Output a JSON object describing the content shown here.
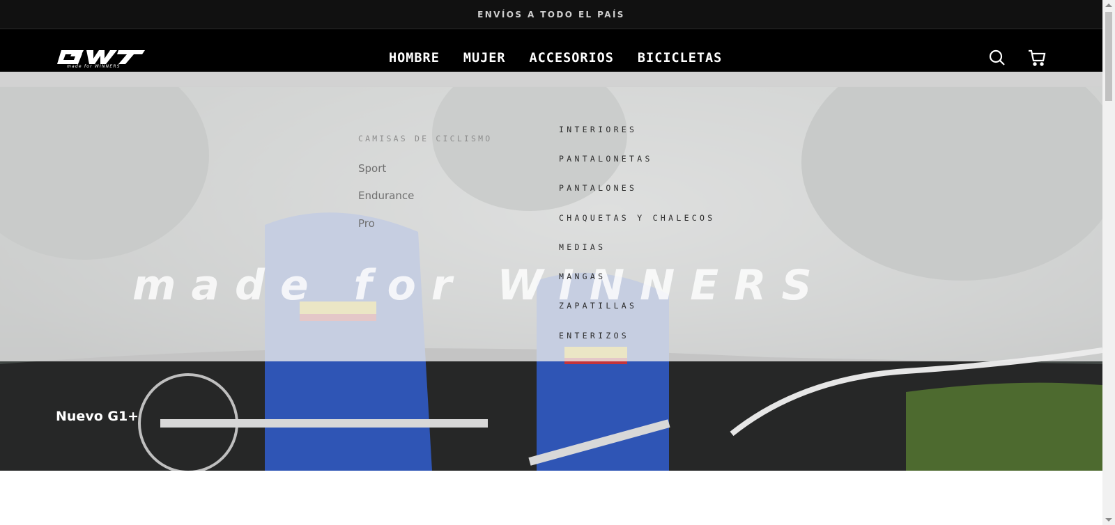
{
  "announcement": {
    "text": "ENVÍOS A TODO EL PAÍS"
  },
  "header": {
    "logo_text": "GW",
    "logo_tagline": "made for WINNERS",
    "nav": [
      {
        "label": "HOMBRE"
      },
      {
        "label": "MUJER"
      },
      {
        "label": "ACCESORIOS"
      },
      {
        "label": "BICICLETAS"
      }
    ],
    "search_icon": "search-icon",
    "cart_icon": "cart-icon"
  },
  "mega_menu": {
    "column1": {
      "heading": "CAMISAS DE CICLISMO",
      "items": [
        "Sport",
        "Endurance",
        "Pro"
      ]
    },
    "column2": {
      "items": [
        "INTERIORES",
        "PANTALONETAS",
        "PANTALONES",
        "CHAQUETAS Y CHALECOS",
        "MEDIAS",
        "MANGAS",
        "ZAPATILLAS",
        "ENTERIZOS"
      ]
    }
  },
  "hero": {
    "watermark": "made for WINNERS",
    "title": "Nuevo G1+"
  },
  "colors": {
    "announce_bg": "#111111",
    "header_bg": "#000000",
    "menu_overlay": "#ececec",
    "text_white": "#ffffff"
  }
}
